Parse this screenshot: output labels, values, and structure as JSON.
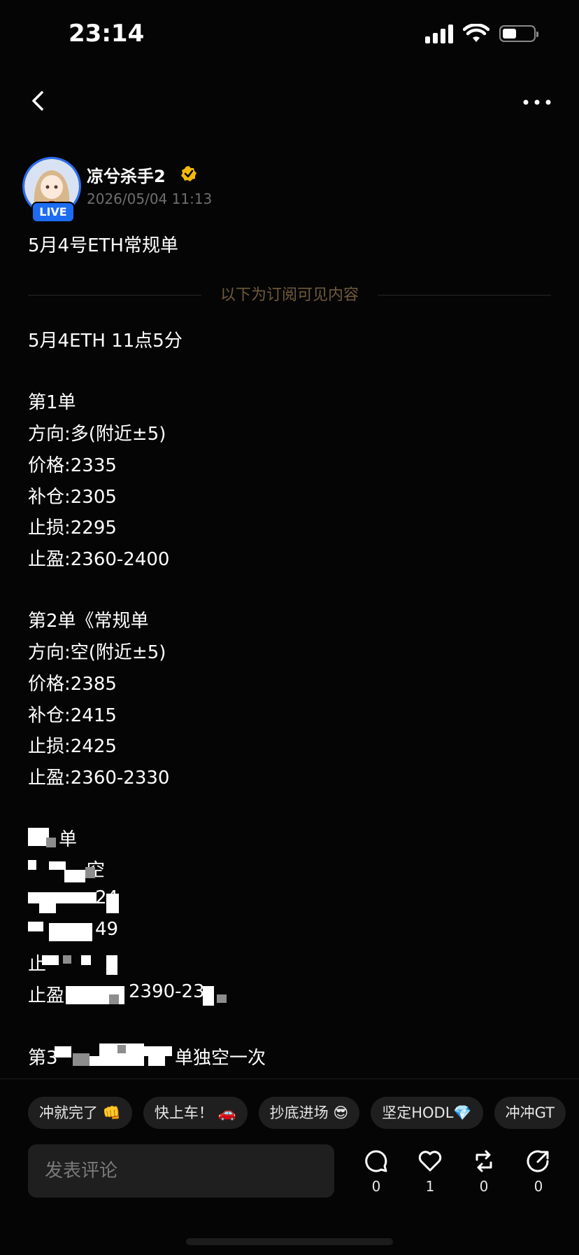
{
  "status_bar": {
    "time": "23:14",
    "battery_level": 0.45
  },
  "nav": {
    "back_icon": "chevron-left-icon",
    "more_icon": "more-dots-icon"
  },
  "author": {
    "name": "凉兮杀手2",
    "live_badge": "LIVE",
    "timestamp": "2026/05/04 11:13",
    "verified_color": "#f0b90b"
  },
  "post": {
    "title": "5月4号ETH常规单",
    "divider_label": "以下为订阅可见内容",
    "lines": [
      "5月4ETH 11点5分",
      "第1单",
      "方向:多(附近±5)",
      "价格:2335",
      "补仓:2305",
      "止损:2295",
      "止盈:2360-2400",
      "第2单《常规单",
      "方向:空(附近±5)",
      "价格:2385",
      "补仓:2415",
      "止损:2425",
      "止盈:2360-2330",
      "单",
      "空",
      "24",
      "49",
      "止",
      "止盈",
      "2390-23",
      "第3",
      "单独空一次"
    ]
  },
  "reactions": [
    {
      "label": "冲就完了 👊"
    },
    {
      "label": "快上车！ 🚗"
    },
    {
      "label": "抄底进场 😎"
    },
    {
      "label": "坚定HODL💎"
    },
    {
      "label": "冲冲GT"
    }
  ],
  "comment": {
    "placeholder": "发表评论"
  },
  "actions": {
    "comment_count": "0",
    "like_count": "1",
    "repost_count": "0",
    "share_count": "0"
  },
  "colors": {
    "accent": "#1d6cf2",
    "gold": "#f0b90b",
    "divider_text": "#6f5a3c"
  }
}
